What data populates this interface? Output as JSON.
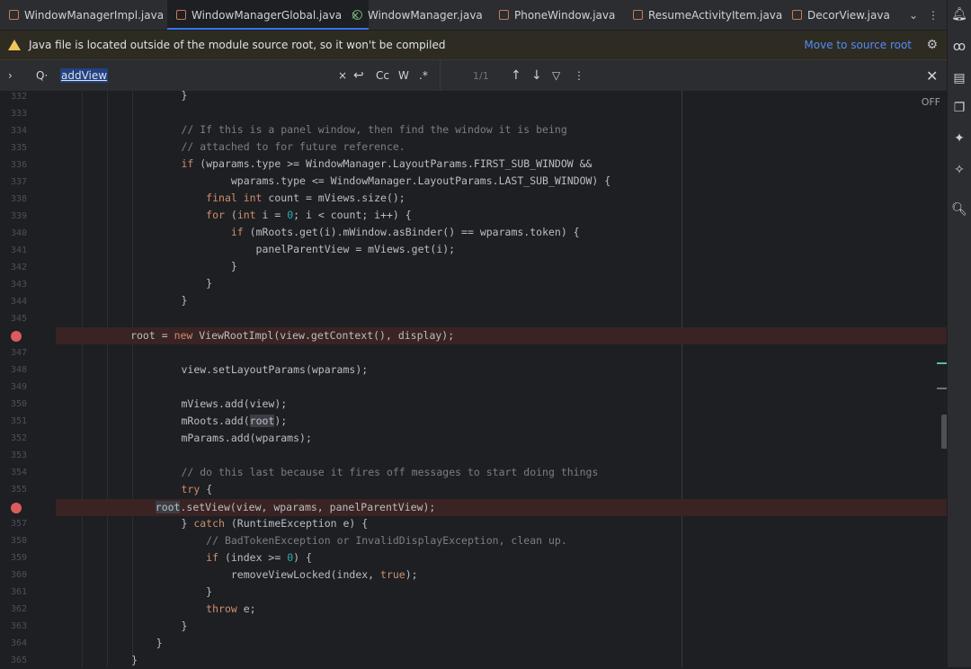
{
  "tabs": [
    {
      "label": "WindowManagerImpl.java",
      "icon": "java-class-icon",
      "active": false
    },
    {
      "label": "WindowManagerGlobal.java",
      "icon": "java-class-icon",
      "active": true
    },
    {
      "label": "WindowManager.java",
      "icon": "interface-icon",
      "active": false
    },
    {
      "label": "PhoneWindow.java",
      "icon": "java-class-icon",
      "active": false
    },
    {
      "label": "ResumeActivityItem.java",
      "icon": "java-class-icon",
      "active": false
    },
    {
      "label": "DecorView.java",
      "icon": "java-class-icon",
      "active": false
    }
  ],
  "tab_close": "×",
  "banner": {
    "message": "Java file is located outside of the module source root, so it won't be compiled",
    "link": "Move to source root"
  },
  "find": {
    "query": "addView",
    "case_label": "Cc",
    "words_label": "W",
    "regex_label": ".*",
    "match_count": "1/1",
    "clear": "×"
  },
  "editor": {
    "off_label": "OFF",
    "line_numbers": [
      "332",
      "333",
      "334",
      "335",
      "336",
      "337",
      "338",
      "339",
      "340",
      "341",
      "342",
      "343",
      "344",
      "345",
      "346",
      "347",
      "348",
      "349",
      "350",
      "351",
      "352",
      "353",
      "354",
      "355",
      "356",
      "357",
      "358",
      "359",
      "360",
      "361",
      "362",
      "363",
      "364",
      "365"
    ],
    "breakpoint_lines": [
      "346",
      "356"
    ]
  },
  "colors": {
    "accent": "#3574f0",
    "breakpoint": "#db5c5c",
    "keyword": "#cf8e6d",
    "comment": "#7a7e85",
    "number": "#2aacb8",
    "link": "#548af7"
  }
}
